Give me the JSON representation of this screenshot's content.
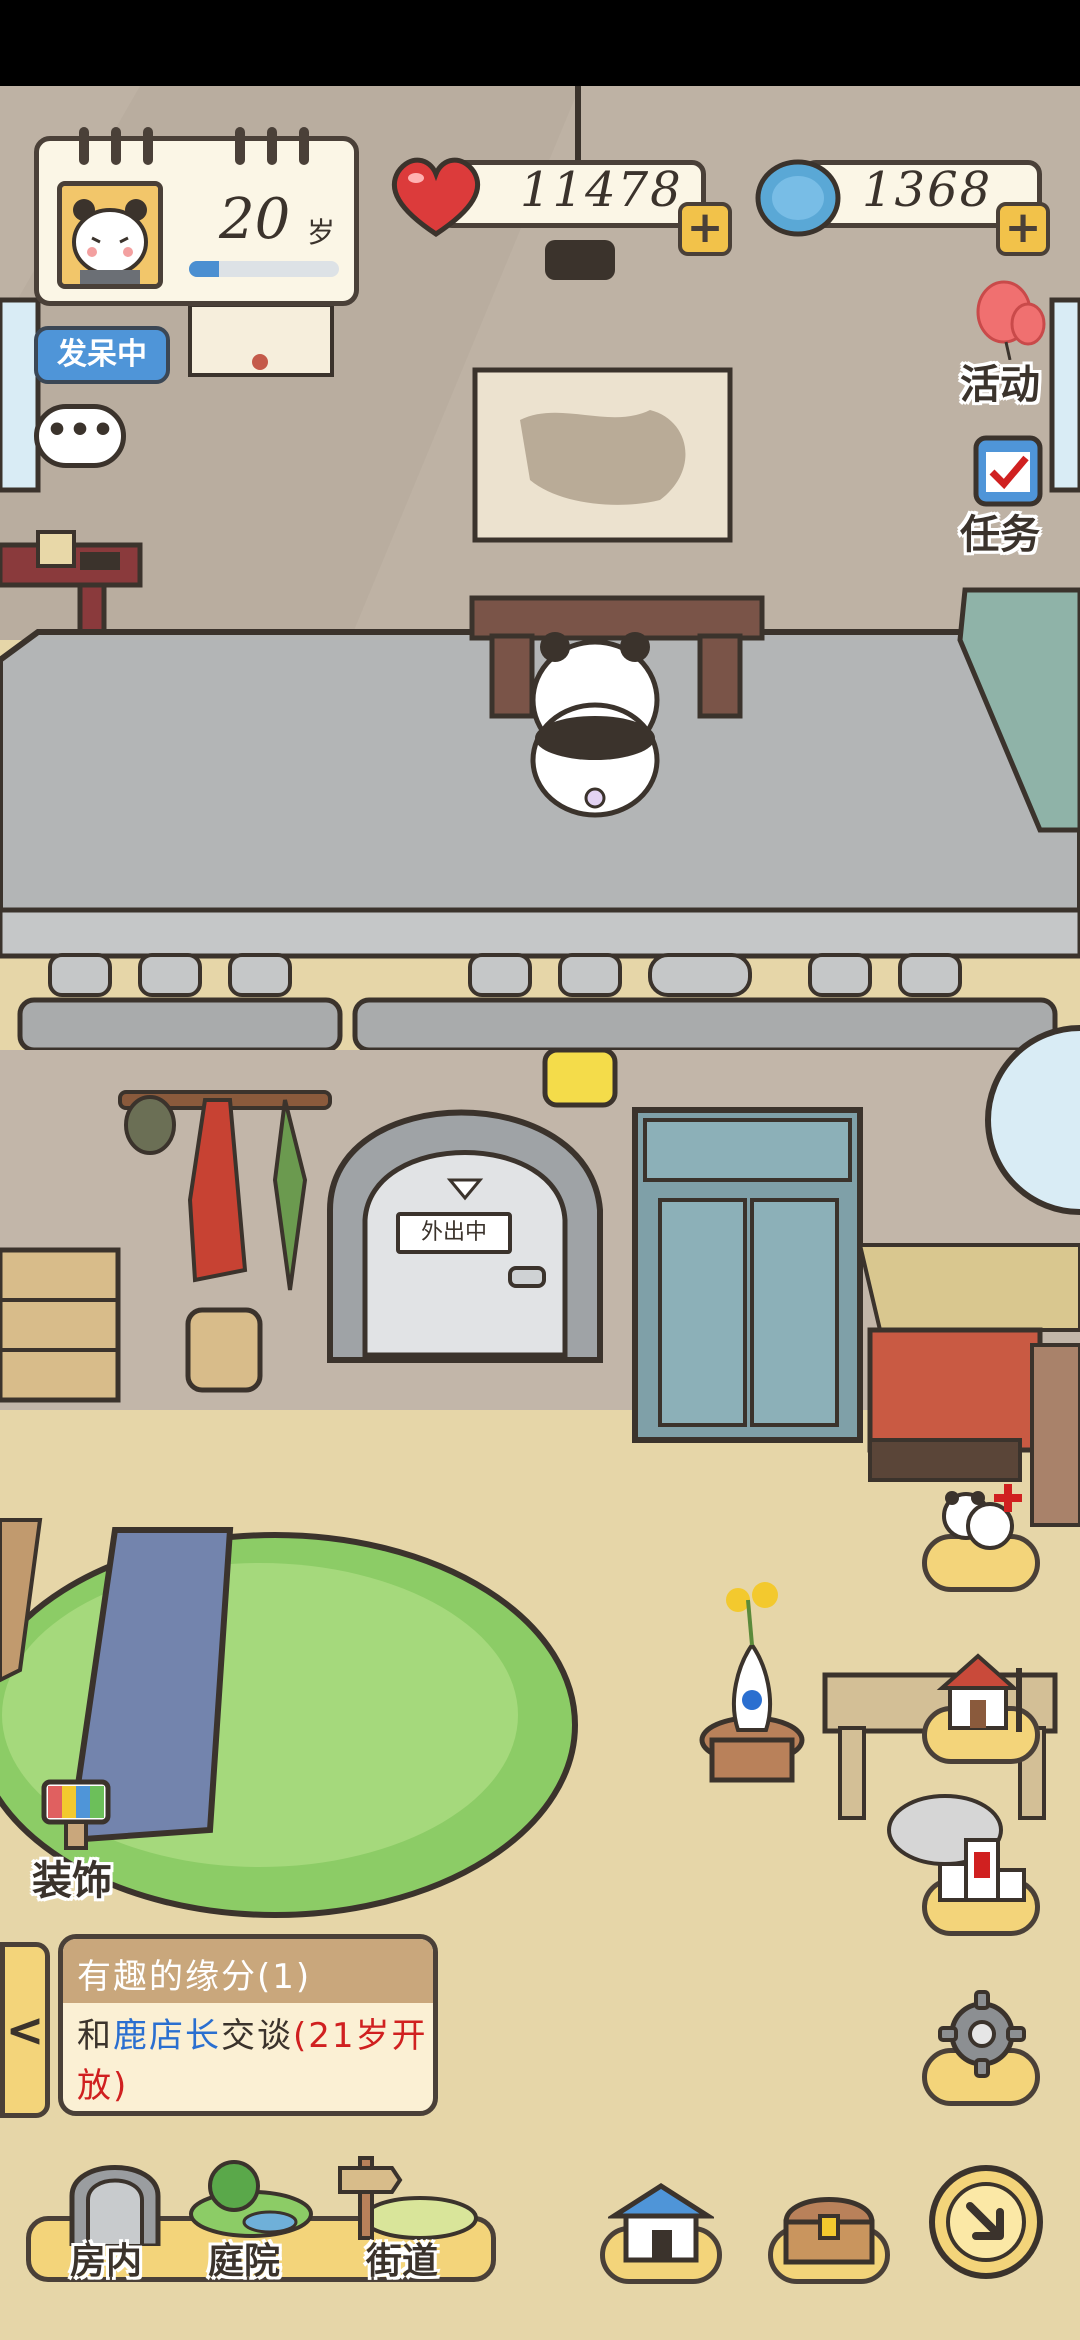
{
  "profile": {
    "age_value": "20",
    "age_unit": "岁",
    "age_progress": 0.2,
    "status": "发呆中",
    "chat_icon": "speech-bubble-icon"
  },
  "currency": {
    "hearts": "11478",
    "clovers": "1368",
    "add_symbol": "+"
  },
  "side_menu": {
    "activity_label": "活动",
    "task_label": "任务"
  },
  "room": {
    "door_sign": "外出中",
    "decorate_label": "装饰"
  },
  "quest": {
    "title": "有趣的缘分(1)",
    "line_prefix": "和",
    "npc_name": "鹿店长",
    "line_action": "交谈",
    "line_note": "(21岁开放)",
    "collapse_arrow": "<"
  },
  "bottom_nav": {
    "tabs": [
      {
        "label": "房内"
      },
      {
        "label": "庭院"
      },
      {
        "label": "街道"
      }
    ]
  },
  "colors": {
    "wall": "#bfb3a5",
    "floor": "#e6d6a8",
    "loft": "#b5b7b8",
    "rug": "#9ccf72",
    "accent_blue": "#4f95d8",
    "pad_yellow": "#f3d47a"
  }
}
